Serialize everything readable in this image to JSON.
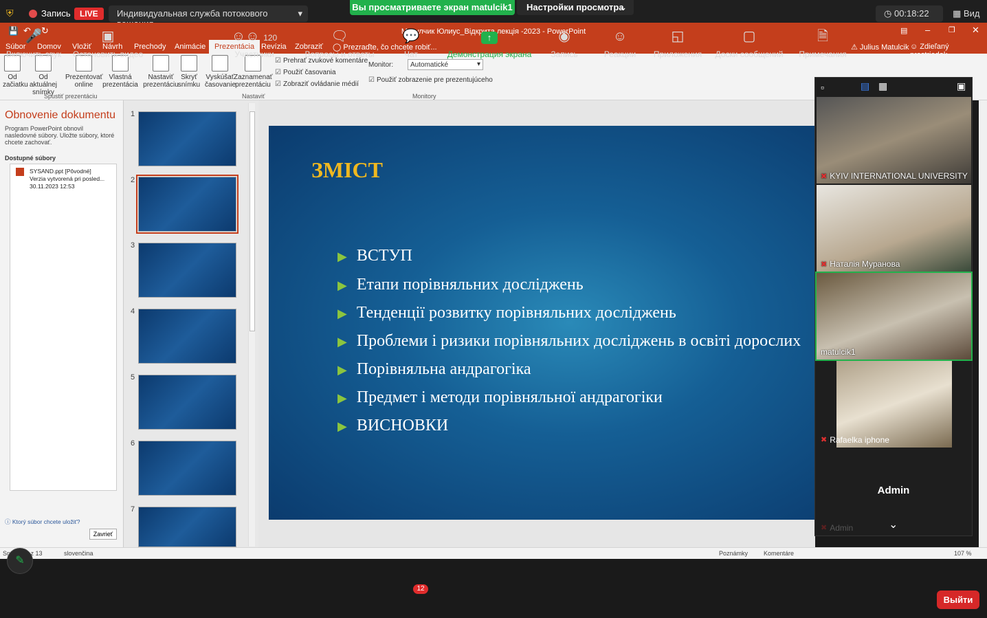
{
  "zoom_top": {
    "record": "Запись",
    "live": "LIVE",
    "service": "Индивидуальная служба потокового вещания",
    "viewing": "Вы просматриваете экран matulcik1",
    "view_settings": "Настройки просмотра",
    "timer": "00:18:22",
    "view": "Вид"
  },
  "ppt": {
    "title": "Матулчик Юлиус_Відкрита лекція -2023 - PowerPoint",
    "tabs": [
      "Súbor",
      "Domov",
      "Vložiť",
      "Návrh",
      "Prechody",
      "Animácie",
      "Prezentácia",
      "Revízia",
      "Zobraziť",
      "Prezraďte, čo chcete robiť..."
    ],
    "user": "Julius Matulcik",
    "share": "Zdieľaný prostriedok",
    "ribbon": {
      "b1": "Od začiatku",
      "b2": "Od aktuálnej snímky",
      "b3": "Prezentovať online",
      "b4": "Vlastná prezentácia",
      "b5": "Nastaviť prezentáciu",
      "b6": "Skryť snímku",
      "b7": "Vyskúšať časovanie",
      "b8": "Zaznamenať prezentáciu",
      "c1": "Prehrať zvukové komentáre",
      "c2": "Použiť časovania",
      "c3": "Zobraziť ovládanie médií",
      "monitor": "Monitor:",
      "monitor_val": "Automatické",
      "c4": "Použiť zobrazenie pre prezentujúceho",
      "g1": "Spustiť prezentáciu",
      "g2": "Nastaviť",
      "g3": "Monitory"
    },
    "recovery": {
      "title": "Obnovenie dokumentu",
      "desc": "Program PowerPoint obnovil nasledovné súbory. Uložte súbory, ktoré chcete zachovať.",
      "avail": "Dostupné súbory",
      "file": "SYSAND.ppt  [Pôvodné]",
      "file2": "Verzia vytvorená pri posled...",
      "file3": "30.11.2023 12:53",
      "which": "Ktorý súbor chcete uložiť?",
      "close": "Zavrieť"
    },
    "thumb_nums": [
      "1",
      "2",
      "3",
      "4",
      "5",
      "6",
      "7"
    ],
    "slide": {
      "title": "ЗМІСТ",
      "bullets": [
        "ВСТУП",
        "Етапи порівняльних досліджень",
        "Тенденції розвитку  порівняльних досліджень",
        "Проблеми і ризики порівняльних досліджень в освіті дорослих",
        "Порівняльна андрагогіка",
        "Предмет і методи порівняльної андрагогіки",
        "ВИСНОВКИ"
      ]
    },
    "status": {
      "slide": "Snímka 2 z 13",
      "lang": "slovenčina",
      "notes": "Poznámky",
      "comments": "Komentáre",
      "zoom": "107 %"
    }
  },
  "participants": [
    "KYIV INTERNATIONAL UNIVERSITY",
    "Наталія Муранова",
    "matulcik1",
    "Rafaelka iphone",
    "Admin"
  ],
  "admin_dim": "Admin",
  "zoom_bottom": {
    "mic": "Включить звук",
    "video": "Остановить видео",
    "participants": "Участники",
    "count": "120",
    "qa": "Вопросы и ответы",
    "chat": "Чат",
    "chat_badge": "12",
    "share": "Демонстрация экрана",
    "record": "Запись",
    "reactions": "Реакции",
    "apps": "Приложения",
    "boards": "Доски сообщений",
    "notes": "Примечания",
    "exit": "Выйти"
  }
}
